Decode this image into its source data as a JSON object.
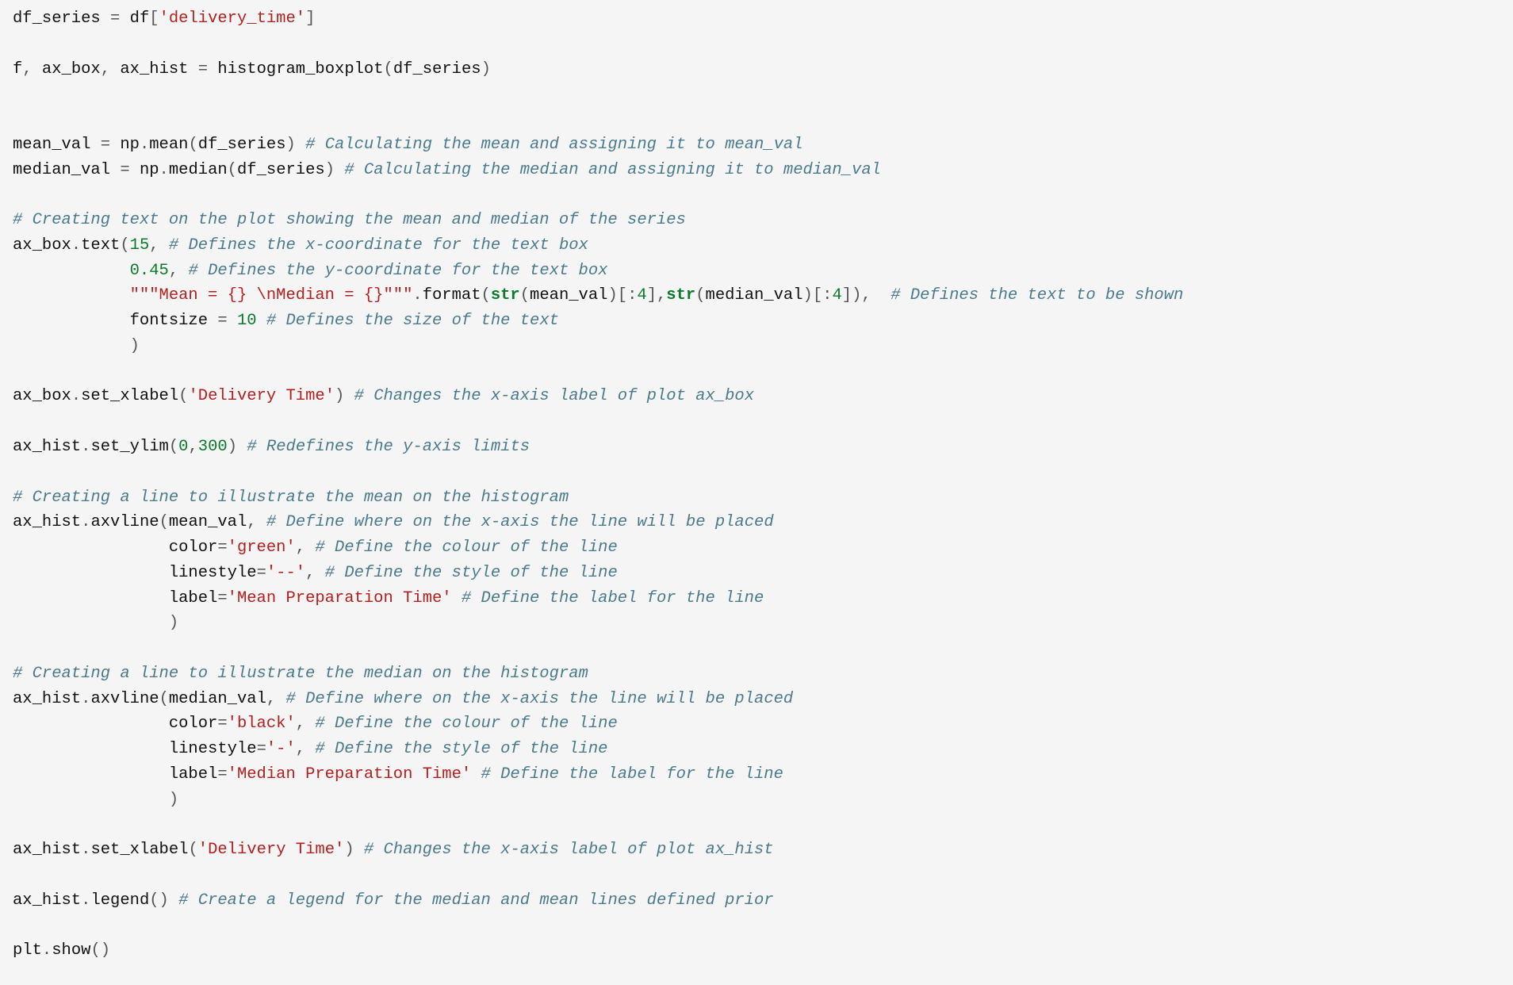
{
  "lines": [
    [
      {
        "t": "df_series ",
        "cls": "c-name"
      },
      {
        "t": "=",
        "cls": "c-op"
      },
      {
        "t": " df",
        "cls": "c-name"
      },
      {
        "t": "[",
        "cls": "c-op"
      },
      {
        "t": "'delivery_time'",
        "cls": "c-str"
      },
      {
        "t": "]",
        "cls": "c-op"
      }
    ],
    [],
    [
      {
        "t": "f",
        "cls": "c-name"
      },
      {
        "t": ",",
        "cls": "c-op"
      },
      {
        "t": " ax_box",
        "cls": "c-name"
      },
      {
        "t": ",",
        "cls": "c-op"
      },
      {
        "t": " ax_hist ",
        "cls": "c-name"
      },
      {
        "t": "=",
        "cls": "c-op"
      },
      {
        "t": " histogram_boxplot",
        "cls": "c-call"
      },
      {
        "t": "(",
        "cls": "c-op"
      },
      {
        "t": "df_series",
        "cls": "c-name"
      },
      {
        "t": ")",
        "cls": "c-op"
      }
    ],
    [],
    [],
    [
      {
        "t": "mean_val ",
        "cls": "c-name"
      },
      {
        "t": "=",
        "cls": "c-op"
      },
      {
        "t": " np",
        "cls": "c-name"
      },
      {
        "t": ".",
        "cls": "c-op"
      },
      {
        "t": "mean",
        "cls": "c-call"
      },
      {
        "t": "(",
        "cls": "c-op"
      },
      {
        "t": "df_series",
        "cls": "c-name"
      },
      {
        "t": ") ",
        "cls": "c-op"
      },
      {
        "t": "# Calculating the mean and assigning it to mean_val",
        "cls": "c-comment"
      }
    ],
    [
      {
        "t": "median_val ",
        "cls": "c-name"
      },
      {
        "t": "=",
        "cls": "c-op"
      },
      {
        "t": " np",
        "cls": "c-name"
      },
      {
        "t": ".",
        "cls": "c-op"
      },
      {
        "t": "median",
        "cls": "c-call"
      },
      {
        "t": "(",
        "cls": "c-op"
      },
      {
        "t": "df_series",
        "cls": "c-name"
      },
      {
        "t": ") ",
        "cls": "c-op"
      },
      {
        "t": "# Calculating the median and assigning it to median_val",
        "cls": "c-comment"
      }
    ],
    [],
    [
      {
        "t": "# Creating text on the plot showing the mean and median of the series",
        "cls": "c-comment"
      }
    ],
    [
      {
        "t": "ax_box",
        "cls": "c-name"
      },
      {
        "t": ".",
        "cls": "c-op"
      },
      {
        "t": "text",
        "cls": "c-call"
      },
      {
        "t": "(",
        "cls": "c-op"
      },
      {
        "t": "15",
        "cls": "c-num"
      },
      {
        "t": ",",
        "cls": "c-op"
      },
      {
        "t": " ",
        "cls": "c-default"
      },
      {
        "t": "# Defines the x-coordinate for the text box",
        "cls": "c-comment"
      }
    ],
    [
      {
        "t": "            ",
        "cls": "c-default"
      },
      {
        "t": "0.45",
        "cls": "c-num"
      },
      {
        "t": ",",
        "cls": "c-op"
      },
      {
        "t": " ",
        "cls": "c-default"
      },
      {
        "t": "# Defines the y-coordinate for the text box",
        "cls": "c-comment"
      }
    ],
    [
      {
        "t": "            ",
        "cls": "c-default"
      },
      {
        "t": "\"\"\"Mean = {} \\nMedian = {}\"\"\"",
        "cls": "c-str"
      },
      {
        "t": ".",
        "cls": "c-op"
      },
      {
        "t": "format",
        "cls": "c-call"
      },
      {
        "t": "(",
        "cls": "c-op"
      },
      {
        "t": "str",
        "cls": "c-kw"
      },
      {
        "t": "(",
        "cls": "c-op"
      },
      {
        "t": "mean_val",
        "cls": "c-name"
      },
      {
        "t": ")[:",
        "cls": "c-op"
      },
      {
        "t": "4",
        "cls": "c-num"
      },
      {
        "t": "],",
        "cls": "c-op"
      },
      {
        "t": "str",
        "cls": "c-kw"
      },
      {
        "t": "(",
        "cls": "c-op"
      },
      {
        "t": "median_val",
        "cls": "c-name"
      },
      {
        "t": ")[:",
        "cls": "c-op"
      },
      {
        "t": "4",
        "cls": "c-num"
      },
      {
        "t": "]),  ",
        "cls": "c-op"
      },
      {
        "t": "# Defines the text to be shown",
        "cls": "c-comment"
      }
    ],
    [
      {
        "t": "            fontsize ",
        "cls": "c-name"
      },
      {
        "t": "=",
        "cls": "c-op"
      },
      {
        "t": " ",
        "cls": "c-default"
      },
      {
        "t": "10",
        "cls": "c-num"
      },
      {
        "t": " ",
        "cls": "c-default"
      },
      {
        "t": "# Defines the size of the text",
        "cls": "c-comment"
      }
    ],
    [
      {
        "t": "            )",
        "cls": "c-op"
      }
    ],
    [],
    [
      {
        "t": "ax_box",
        "cls": "c-name"
      },
      {
        "t": ".",
        "cls": "c-op"
      },
      {
        "t": "set_xlabel",
        "cls": "c-call"
      },
      {
        "t": "(",
        "cls": "c-op"
      },
      {
        "t": "'Delivery Time'",
        "cls": "c-str"
      },
      {
        "t": ") ",
        "cls": "c-op"
      },
      {
        "t": "# Changes the x-axis label of plot ax_box",
        "cls": "c-comment"
      }
    ],
    [],
    [
      {
        "t": "ax_hist",
        "cls": "c-name"
      },
      {
        "t": ".",
        "cls": "c-op"
      },
      {
        "t": "set_ylim",
        "cls": "c-call"
      },
      {
        "t": "(",
        "cls": "c-op"
      },
      {
        "t": "0",
        "cls": "c-num"
      },
      {
        "t": ",",
        "cls": "c-op"
      },
      {
        "t": "300",
        "cls": "c-num"
      },
      {
        "t": ") ",
        "cls": "c-op"
      },
      {
        "t": "# Redefines the y-axis limits",
        "cls": "c-comment"
      }
    ],
    [],
    [
      {
        "t": "# Creating a line to illustrate the mean on the histogram",
        "cls": "c-comment"
      }
    ],
    [
      {
        "t": "ax_hist",
        "cls": "c-name"
      },
      {
        "t": ".",
        "cls": "c-op"
      },
      {
        "t": "axvline",
        "cls": "c-call"
      },
      {
        "t": "(",
        "cls": "c-op"
      },
      {
        "t": "mean_val",
        "cls": "c-name"
      },
      {
        "t": ",",
        "cls": "c-op"
      },
      {
        "t": " ",
        "cls": "c-default"
      },
      {
        "t": "# Define where on the x-axis the line will be placed",
        "cls": "c-comment"
      }
    ],
    [
      {
        "t": "                color",
        "cls": "c-name"
      },
      {
        "t": "=",
        "cls": "c-op"
      },
      {
        "t": "'green'",
        "cls": "c-str"
      },
      {
        "t": ",",
        "cls": "c-op"
      },
      {
        "t": " ",
        "cls": "c-default"
      },
      {
        "t": "# Define the colour of the line",
        "cls": "c-comment"
      }
    ],
    [
      {
        "t": "                linestyle",
        "cls": "c-name"
      },
      {
        "t": "=",
        "cls": "c-op"
      },
      {
        "t": "'--'",
        "cls": "c-str"
      },
      {
        "t": ",",
        "cls": "c-op"
      },
      {
        "t": " ",
        "cls": "c-default"
      },
      {
        "t": "# Define the style of the line",
        "cls": "c-comment"
      }
    ],
    [
      {
        "t": "                label",
        "cls": "c-name"
      },
      {
        "t": "=",
        "cls": "c-op"
      },
      {
        "t": "'Mean Preparation Time'",
        "cls": "c-str"
      },
      {
        "t": " ",
        "cls": "c-default"
      },
      {
        "t": "# Define the label for the line",
        "cls": "c-comment"
      }
    ],
    [
      {
        "t": "                )",
        "cls": "c-op"
      }
    ],
    [],
    [
      {
        "t": "# Creating a line to illustrate the median on the histogram",
        "cls": "c-comment"
      }
    ],
    [
      {
        "t": "ax_hist",
        "cls": "c-name"
      },
      {
        "t": ".",
        "cls": "c-op"
      },
      {
        "t": "axvline",
        "cls": "c-call"
      },
      {
        "t": "(",
        "cls": "c-op"
      },
      {
        "t": "median_val",
        "cls": "c-name"
      },
      {
        "t": ",",
        "cls": "c-op"
      },
      {
        "t": " ",
        "cls": "c-default"
      },
      {
        "t": "# Define where on the x-axis the line will be placed",
        "cls": "c-comment"
      }
    ],
    [
      {
        "t": "                color",
        "cls": "c-name"
      },
      {
        "t": "=",
        "cls": "c-op"
      },
      {
        "t": "'black'",
        "cls": "c-str"
      },
      {
        "t": ",",
        "cls": "c-op"
      },
      {
        "t": " ",
        "cls": "c-default"
      },
      {
        "t": "# Define the colour of the line",
        "cls": "c-comment"
      }
    ],
    [
      {
        "t": "                linestyle",
        "cls": "c-name"
      },
      {
        "t": "=",
        "cls": "c-op"
      },
      {
        "t": "'-'",
        "cls": "c-str"
      },
      {
        "t": ",",
        "cls": "c-op"
      },
      {
        "t": " ",
        "cls": "c-default"
      },
      {
        "t": "# Define the style of the line",
        "cls": "c-comment"
      }
    ],
    [
      {
        "t": "                label",
        "cls": "c-name"
      },
      {
        "t": "=",
        "cls": "c-op"
      },
      {
        "t": "'Median Preparation Time'",
        "cls": "c-str"
      },
      {
        "t": " ",
        "cls": "c-default"
      },
      {
        "t": "# Define the label for the line",
        "cls": "c-comment"
      }
    ],
    [
      {
        "t": "                )",
        "cls": "c-op"
      }
    ],
    [],
    [
      {
        "t": "ax_hist",
        "cls": "c-name"
      },
      {
        "t": ".",
        "cls": "c-op"
      },
      {
        "t": "set_xlabel",
        "cls": "c-call"
      },
      {
        "t": "(",
        "cls": "c-op"
      },
      {
        "t": "'Delivery Time'",
        "cls": "c-str"
      },
      {
        "t": ") ",
        "cls": "c-op"
      },
      {
        "t": "# Changes the x-axis label of plot ax_hist",
        "cls": "c-comment"
      }
    ],
    [],
    [
      {
        "t": "ax_hist",
        "cls": "c-name"
      },
      {
        "t": ".",
        "cls": "c-op"
      },
      {
        "t": "legend",
        "cls": "c-call"
      },
      {
        "t": "() ",
        "cls": "c-op"
      },
      {
        "t": "# Create a legend for the median and mean lines defined prior",
        "cls": "c-comment"
      }
    ],
    [],
    [
      {
        "t": "plt",
        "cls": "c-name"
      },
      {
        "t": ".",
        "cls": "c-op"
      },
      {
        "t": "show",
        "cls": "c-call"
      },
      {
        "t": "()",
        "cls": "c-op"
      }
    ]
  ]
}
